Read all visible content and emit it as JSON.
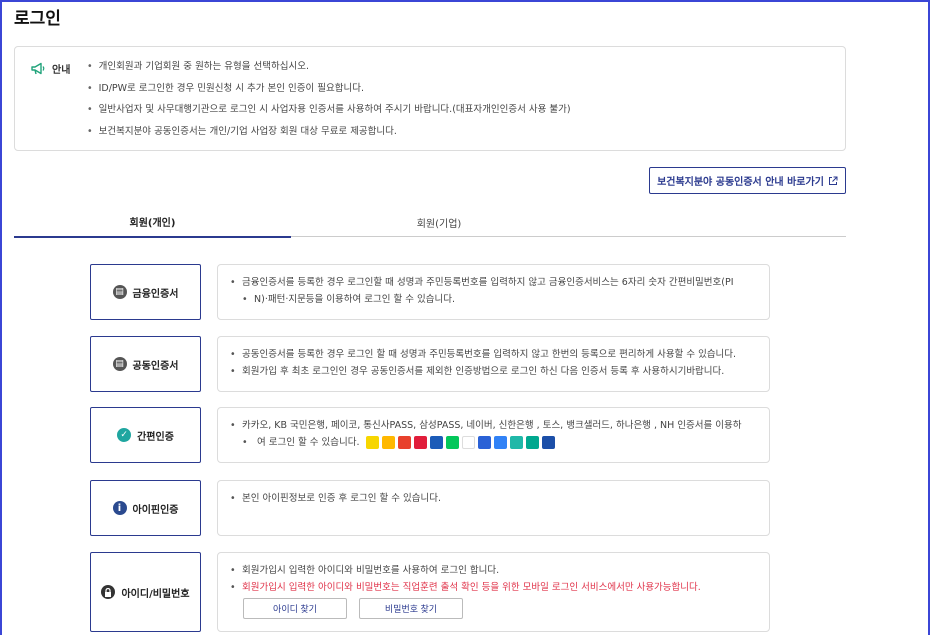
{
  "page": {
    "title": "로그인"
  },
  "notice": {
    "label": "안내",
    "items": [
      "개인회원과 기업회원 중 원하는 유형을 선택하십시오.",
      "ID/PW로 로그인한 경우 민원신청 시 추가 본인 인증이 필요합니다.",
      "일반사업자 및 사무대행기관으로 로그인 시 사업자용 인증서를 사용하여 주시기 바랍니다.(대표자개인인증서 사용 불가)",
      "보건복지분야 공동인증서는 개인/기업 사업장 회원 대상 무료로 제공합니다."
    ]
  },
  "external_button": {
    "label": "보건복지분야 공동인증서 안내 바로가기",
    "icon": "external-link-icon"
  },
  "tabs": [
    {
      "label": "회원(개인)",
      "active": true
    },
    {
      "label": "회원(기업)",
      "active": false
    }
  ],
  "methods": [
    {
      "label": "금융인증서",
      "icon": "certificate-icon",
      "icon_color": "#555555",
      "lines": [
        "금융인증서를 등록한 경우 로그인할 때 성명과 주민등록번호를 입력하지 않고 금융인증서비스는 6자리 숫자 간편비밀번호(PI",
        "N)·패턴·지문등을 이용하여 로그인 할 수 있습니다."
      ]
    },
    {
      "label": "공동인증서",
      "icon": "certificate-icon",
      "icon_color": "#555555",
      "lines": [
        "공동인증서를 등록한 경우 로그인 할 때 성명과 주민등록번호를 입력하지 않고 한번의 등록으로 편리하게 사용할 수 있습니다.",
        "회원가입 후 최초 로그인인 경우 공동인증서를 제외한 인증방법으로 로그인 하신 다음 인증서 등록 후 사용하시기바랍니다."
      ]
    },
    {
      "label": "간편인증",
      "icon": "shield-check-icon",
      "icon_color": "#1fa6a0",
      "lines": [
        "카카오, KB 국민은행, 페이코, 통신사PASS, 삼성PASS, 네이버, 신한은행 , 토스, 뱅크샐러드, 하나은행 , NH 인증서를 이용하",
        "여 로그인 할 수 있습니다."
      ],
      "provider_logo_colors": [
        "#f7d600",
        "#ffb800",
        "#e8412c",
        "#e11d3b",
        "#1b5bb8",
        "#03c75a",
        "#ffffff",
        "#2a61d6",
        "#3182f6",
        "#20b8a8",
        "#00a88f",
        "#1c4fa8"
      ]
    },
    {
      "label": "아이핀인증",
      "icon": "info-icon",
      "icon_color": "#2b4a8f",
      "lines": [
        "본인 아이핀정보로 인증 후 로그인 할 수 있습니다."
      ]
    },
    {
      "label": "아이디/비밀번호",
      "icon": "lock-icon",
      "icon_color": "#333333",
      "lines": [
        "회원가입시 입력한 아이디와 비밀번호를 사용하여 로그인 합니다."
      ],
      "warning": "회원가입시 입력한 아이디와 비밀번호는 직업훈련 출석 확인 등을 위한 모바일 로그인 서비스에서만 사용가능합니다.",
      "buttons": [
        "아이디 찾기",
        "비밀번호 찾기"
      ]
    }
  ]
}
